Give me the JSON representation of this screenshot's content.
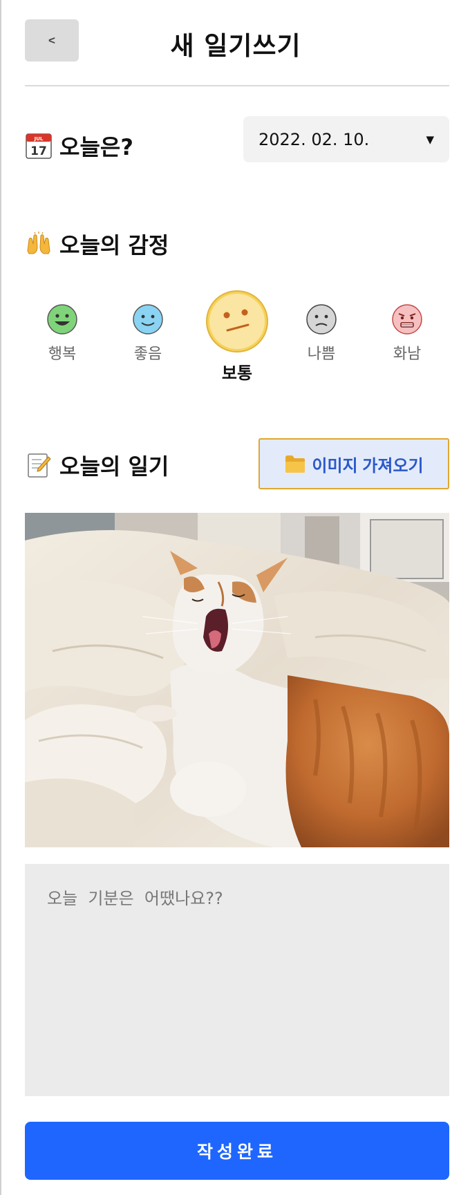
{
  "header": {
    "back_label": "<",
    "title": "새 일기쓰기"
  },
  "date_section": {
    "heading": "오늘은?",
    "icon": "calendar-icon",
    "selected_date": "2022. 02. 10.",
    "calendar_month": "JUL",
    "calendar_day": "17"
  },
  "emotion_section": {
    "heading": "오늘의 감정",
    "icon": "raised-hands-icon",
    "options": [
      {
        "label": "행복",
        "face": "happy",
        "color": "#7fd47a"
      },
      {
        "label": "좋음",
        "face": "good",
        "color": "#8ad3f2"
      },
      {
        "label": "보통",
        "face": "neutral",
        "color": "#f7d25a"
      },
      {
        "label": "나쁨",
        "face": "bad",
        "color": "#d0d0d0"
      },
      {
        "label": "화남",
        "face": "angry",
        "color": "#f3a7a7"
      }
    ],
    "selected": "보통"
  },
  "diary_section": {
    "heading": "오늘의 일기",
    "icon": "memo-icon",
    "import_button_label": "이미지 가져오기",
    "import_icon": "folder-icon",
    "photo": "yawning-cat-photo",
    "textarea_placeholder": "오늘  기분은  어땠나요??"
  },
  "submit_label": "작성완료",
  "colors": {
    "accent": "#1f66ff",
    "import_bg": "#e3ebfb",
    "import_border": "#e0a72e",
    "import_text": "#2b58c9"
  }
}
